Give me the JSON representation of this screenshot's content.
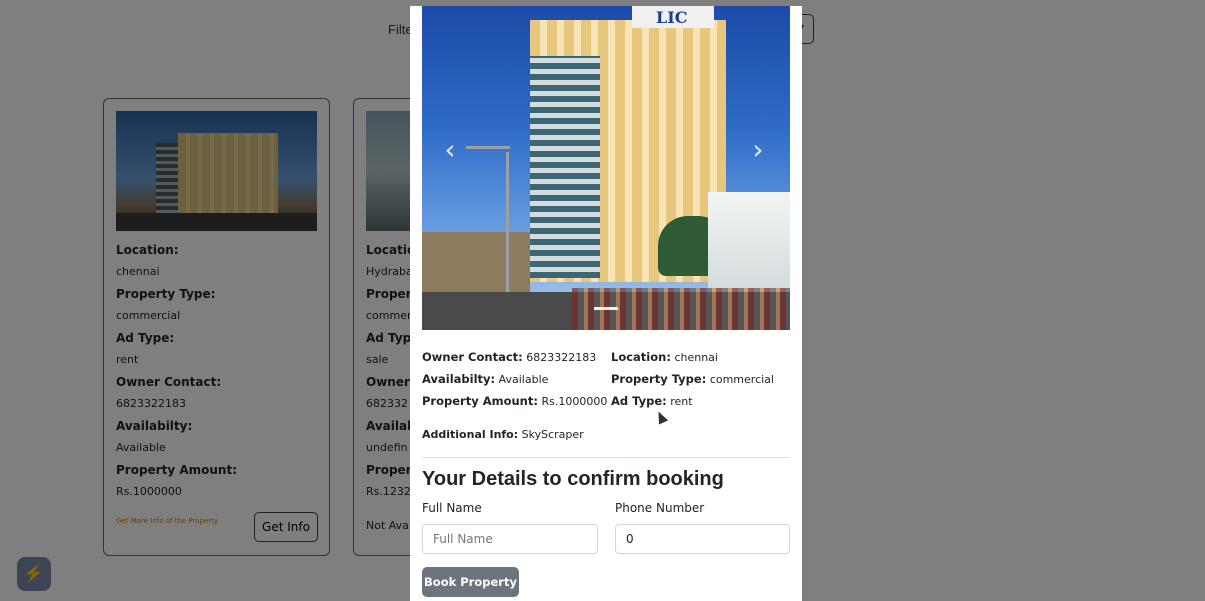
{
  "page": {
    "filter_label": "Filte",
    "widget_icon": "lightning-icon"
  },
  "cards": [
    {
      "location_label": "Location:",
      "location": "chennai",
      "property_type_label": "Property Type:",
      "property_type": "commercial",
      "ad_type_label": "Ad Type:",
      "ad_type": "rent",
      "owner_contact_label": "Owner Contact:",
      "owner_contact": "6823322183",
      "availability_label": "Availabilty:",
      "availability": "Available",
      "amount_label": "Property Amount:",
      "amount": "Rs.1000000",
      "more_info_link": "Get More Info of the Property",
      "get_info_button": "Get Info"
    },
    {
      "location_label": "Locatio",
      "location": "Hydraba",
      "property_type_label": "Proper",
      "property_type": "commer",
      "ad_type_label": "Ad Typ",
      "ad_type": "sale",
      "owner_contact_label": "Owner",
      "owner_contact": "682332",
      "availability_label": "Availab",
      "availability": "undefin",
      "amount_label": "Proper",
      "amount": "Rs.1232",
      "footer_text": "Not Ava"
    }
  ],
  "modal": {
    "carousel": {
      "sign_text": "LIC",
      "prev_glyph": "‹",
      "next_glyph": "›"
    },
    "details": {
      "owner_contact_label": "Owner Contact:",
      "owner_contact": "6823322183",
      "availability_label": "Availabilty:",
      "availability": "Available",
      "amount_label": "Property Amount:",
      "amount": "Rs.1000000",
      "location_label": "Location:",
      "location": "chennai",
      "property_type_label": "Property Type:",
      "property_type": "commercial",
      "ad_type_label": "Ad Type:",
      "ad_type": "rent",
      "additional_label": "Additional Info:",
      "additional": "SkyScraper"
    },
    "booking": {
      "title": "Your Details to confirm booking",
      "name_label": "Full Name",
      "name_placeholder": "Full Name",
      "name_value": "",
      "phone_label": "Phone Number",
      "phone_value": "0",
      "submit_label": "Book Property"
    }
  },
  "colors": {
    "overlay": "#000000",
    "link": "#c58000",
    "button_secondary": "#6c757d"
  }
}
